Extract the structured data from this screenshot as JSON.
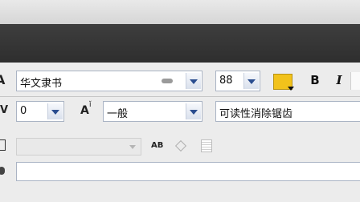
{
  "character_panel": {
    "font_family": {
      "value": "华文隶书"
    },
    "font_size": {
      "value": "88"
    },
    "color": {
      "swatch": "#f2c21b"
    },
    "buttons": {
      "bold": "B",
      "italic": "I"
    },
    "tracking": {
      "value": "0"
    },
    "kerning": {
      "value": "一般"
    },
    "anti_alias": {
      "value": "可读性消除锯齿"
    },
    "icons": {
      "font_icon": "A",
      "tracking_icon": "V",
      "kerning_icon": "A",
      "kerning_superscript": "ǐ",
      "ab_icon": "AB"
    }
  }
}
